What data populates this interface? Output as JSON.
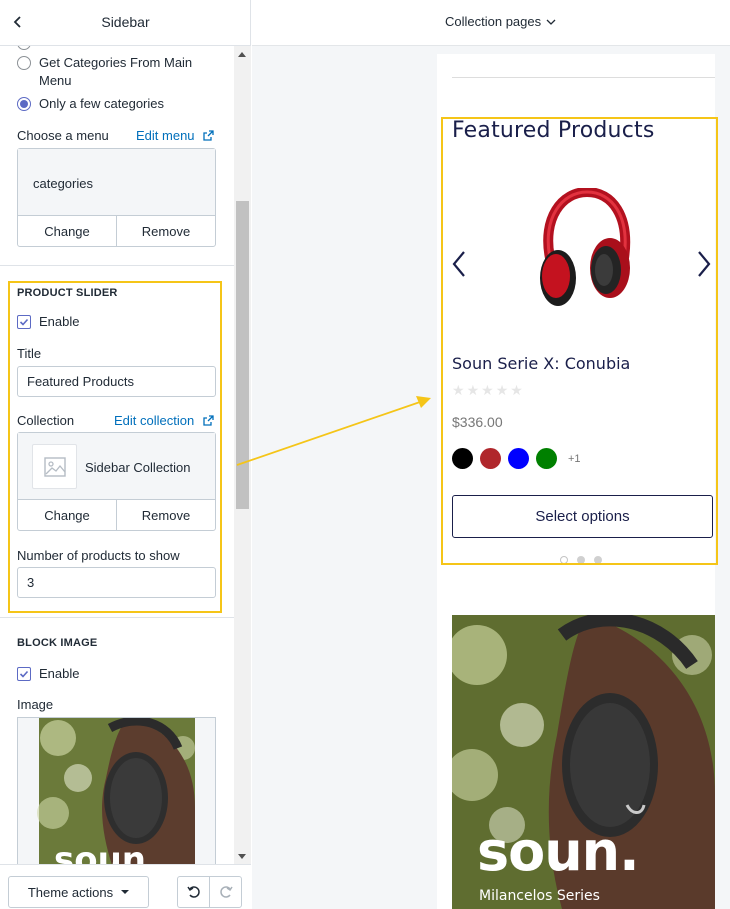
{
  "sidebar": {
    "title": "Sidebar",
    "radio_options": [
      {
        "label": "Get Categories From Main Menu",
        "checked": false
      },
      {
        "label": "Only a few categories",
        "checked": true
      }
    ],
    "choose_menu": {
      "label": "Choose a menu",
      "edit_link": "Edit menu",
      "value": "categories",
      "change_label": "Change",
      "remove_label": "Remove"
    },
    "product_slider": {
      "section_title": "PRODUCT SLIDER",
      "enable_label": "Enable",
      "enabled": true,
      "title_label": "Title",
      "title_value": "Featured Products",
      "collection_label": "Collection",
      "edit_collection_link": "Edit collection",
      "collection_value": "Sidebar Collection",
      "change_label": "Change",
      "remove_label": "Remove",
      "count_label": "Number of products to show",
      "count_value": "3"
    },
    "block_image": {
      "section_title": "BLOCK IMAGE",
      "enable_label": "Enable",
      "enabled": true,
      "image_label": "Image",
      "image_brand": "soun."
    },
    "footer": {
      "theme_actions_label": "Theme actions"
    }
  },
  "preview": {
    "page_selector": "Collection pages",
    "featured": {
      "title": "Featured Products",
      "product_name": "Soun Serie X: Conubia",
      "rating": 0,
      "rating_max": 5,
      "price": "$336.00",
      "swatch_colors": [
        "#000000",
        "#b0272c",
        "#0000ff",
        "#008000"
      ],
      "swatch_more": "+1",
      "select_label": "Select options",
      "slide_dots": 3,
      "active_dot": 1
    },
    "banner": {
      "brand": "soun.",
      "subtitle": "Milancelos Series"
    }
  },
  "colors": {
    "accent": "#5c6ac4",
    "link": "#006fbb",
    "highlight": "#f5c518",
    "brand_navy": "#1a1f4a"
  }
}
